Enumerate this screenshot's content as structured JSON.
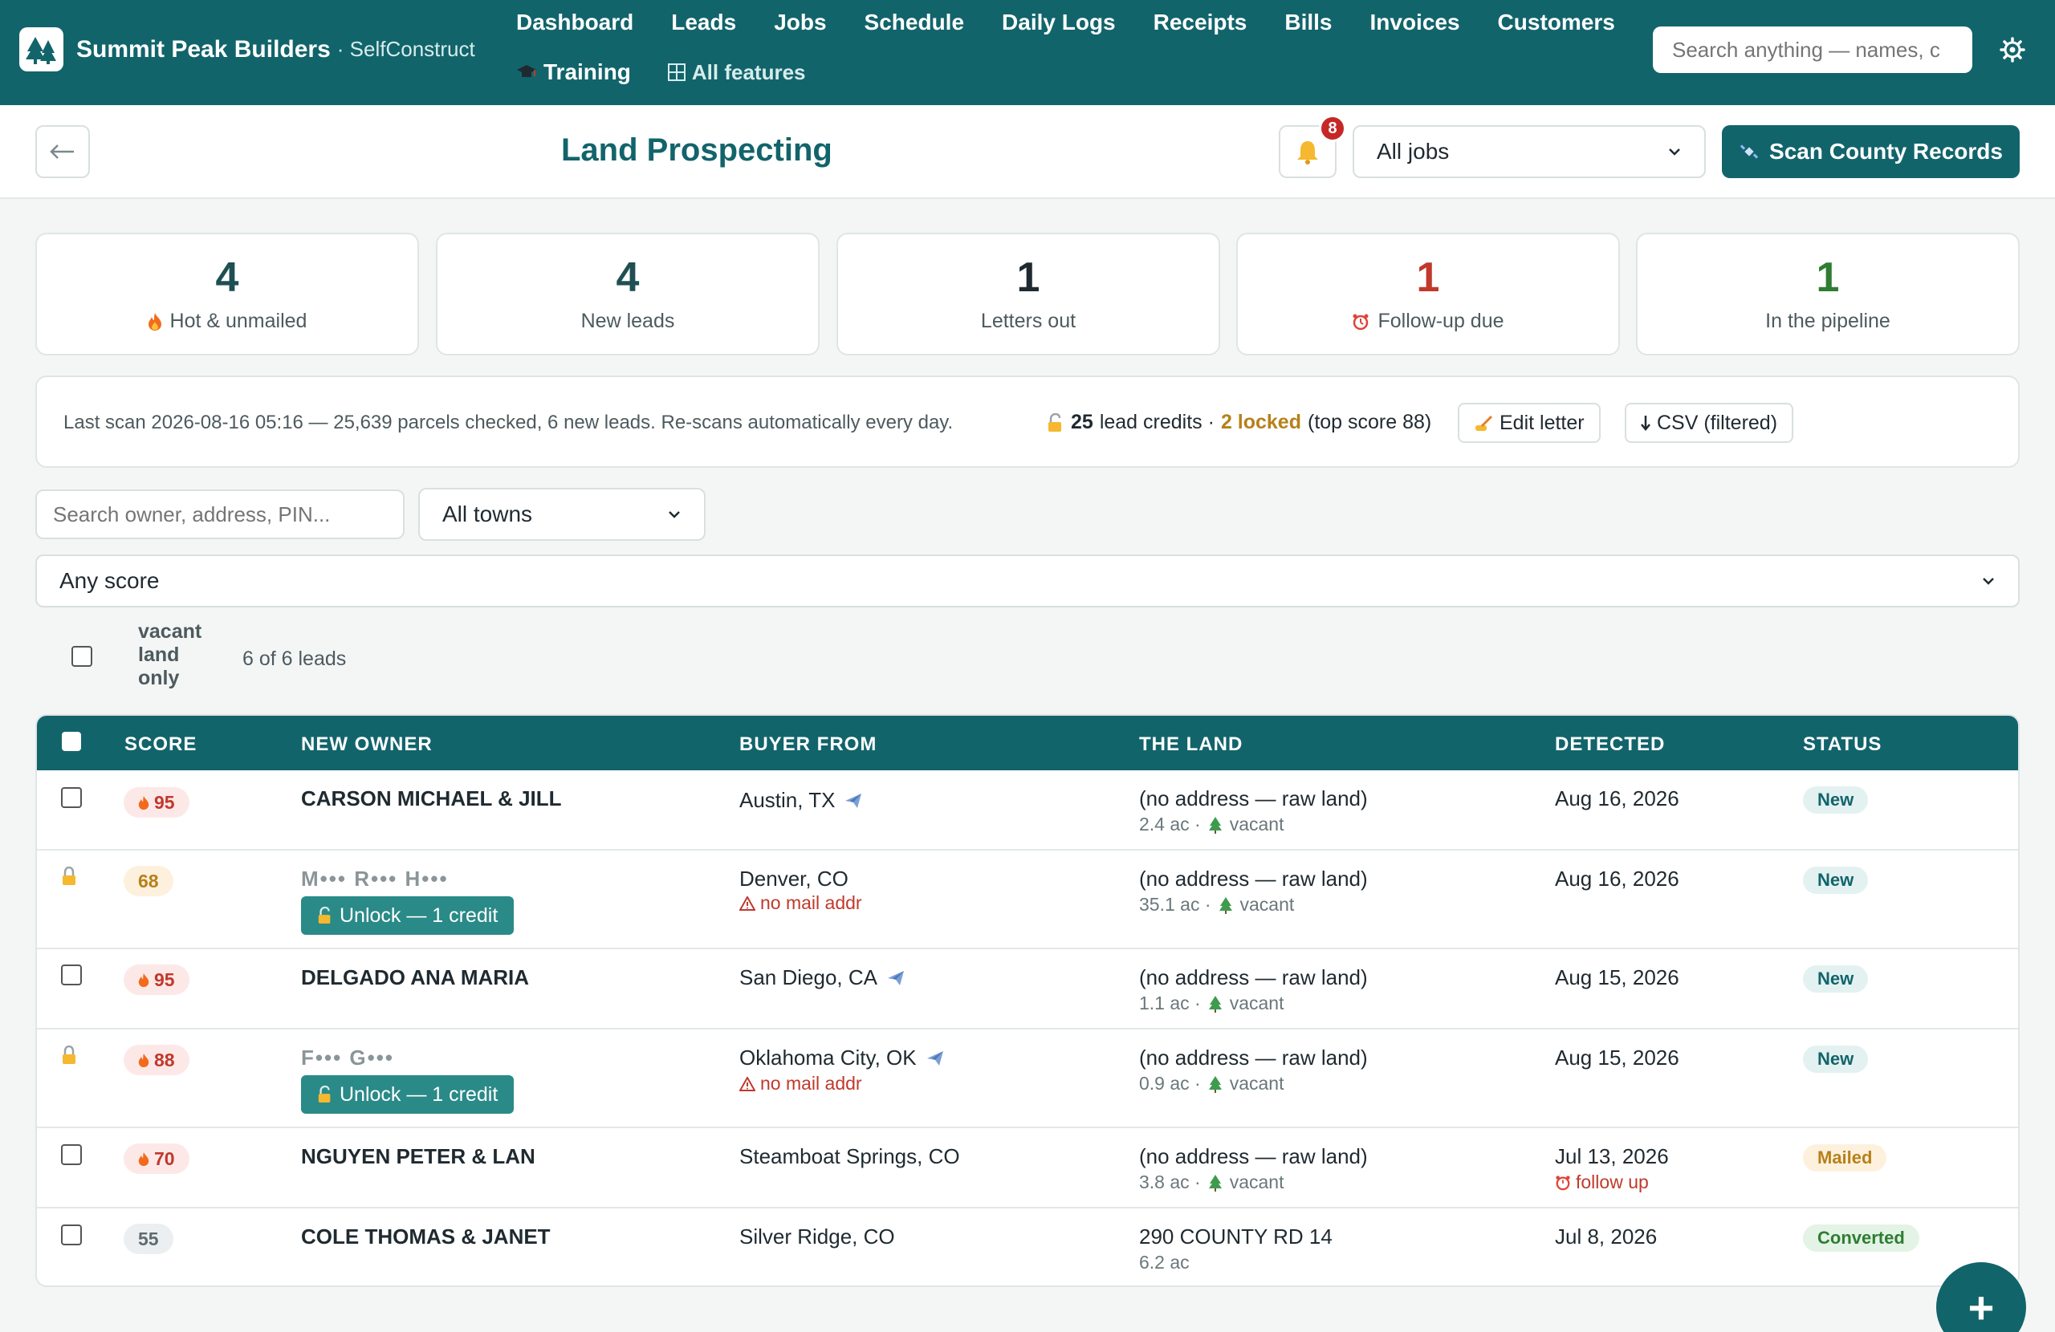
{
  "brand": {
    "name": "Summit Peak Builders",
    "suffix": "· SelfConstruct"
  },
  "nav": {
    "row1": [
      "Dashboard",
      "Leads",
      "Jobs",
      "Schedule",
      "Daily Logs",
      "Receipts",
      "Bills",
      "Invoices",
      "Customers"
    ],
    "training": "Training",
    "all_features": "All features",
    "search_placeholder": "Search anything — names, c"
  },
  "header": {
    "title": "Land Prospecting",
    "back_icon": "arrow-left-icon",
    "notification_count": "8",
    "job_filter": "All jobs",
    "scan_button": "Scan County Records"
  },
  "stats": [
    {
      "value": "4",
      "label": "Hot & unmailed",
      "icon": "fire-icon",
      "color": "#1f4f52"
    },
    {
      "value": "4",
      "label": "New leads",
      "icon": "",
      "color": "#1f4f52"
    },
    {
      "value": "1",
      "label": "Letters out",
      "icon": "",
      "color": "#1f2a30"
    },
    {
      "value": "1",
      "label": "Follow-up due",
      "icon": "alarm-icon",
      "color": "#c0392b"
    },
    {
      "value": "1",
      "label": "In the pipeline",
      "icon": "",
      "color": "#2e7d32"
    }
  ],
  "infobar": {
    "scan_text": "Last scan 2026-08-16 05:16 — 25,639 parcels checked, 6 new leads. Re-scans automatically every day.",
    "credits_count": "25",
    "credits_label": "lead credits ·",
    "locked_text": "2 locked",
    "top_score": "(top score 88)",
    "edit_letter": "Edit letter",
    "csv": "CSV (filtered)"
  },
  "filters": {
    "search_placeholder": "Search owner, address, PIN...",
    "town": "All towns",
    "score": "Any score",
    "vacant_label": "vacant land only",
    "count": "6 of 6 leads"
  },
  "table": {
    "headers": [
      "SCORE",
      "NEW OWNER",
      "BUYER FROM",
      "THE LAND",
      "DETECTED",
      "STATUS"
    ],
    "rows": [
      {
        "score": "95",
        "owner": "CARSON MICHAEL & JILL",
        "buyer": "Austin, TX",
        "land": "(no address — raw land)",
        "acres": "2.4 ac ·",
        "vacant": "vacant",
        "detected": "Aug 16, 2026",
        "status": "New"
      },
      {
        "score": "68",
        "owner": "M••• R••• H•••",
        "unlock": "Unlock — 1 credit",
        "buyer": "Denver, CO",
        "nomail": "no mail addr",
        "land": "(no address — raw land)",
        "acres": "35.1 ac ·",
        "vacant": "vacant",
        "detected": "Aug 16, 2026",
        "status": "New"
      },
      {
        "score": "95",
        "owner": "DELGADO ANA MARIA",
        "buyer": "San Diego, CA",
        "land": "(no address — raw land)",
        "acres": "1.1 ac ·",
        "vacant": "vacant",
        "detected": "Aug 15, 2026",
        "status": "New"
      },
      {
        "score": "88",
        "owner": "F••• G•••",
        "unlock": "Unlock — 1 credit",
        "buyer": "Oklahoma City, OK",
        "nomail": "no mail addr",
        "land": "(no address — raw land)",
        "acres": "0.9 ac ·",
        "vacant": "vacant",
        "detected": "Aug 15, 2026",
        "status": "New"
      },
      {
        "score": "70",
        "owner": "NGUYEN PETER & LAN",
        "buyer": "Steamboat Springs, CO",
        "land": "(no address — raw land)",
        "acres": "3.8 ac ·",
        "vacant": "vacant",
        "detected": "Jul 13, 2026",
        "followup": "follow up",
        "status": "Mailed"
      },
      {
        "score": "55",
        "owner": "COLE THOMAS & JANET",
        "buyer": "Silver Ridge, CO",
        "land": "290 COUNTY RD 14",
        "acres": "6.2 ac",
        "detected": "Jul 8, 2026",
        "status": "Converted"
      }
    ]
  },
  "fab": "+"
}
